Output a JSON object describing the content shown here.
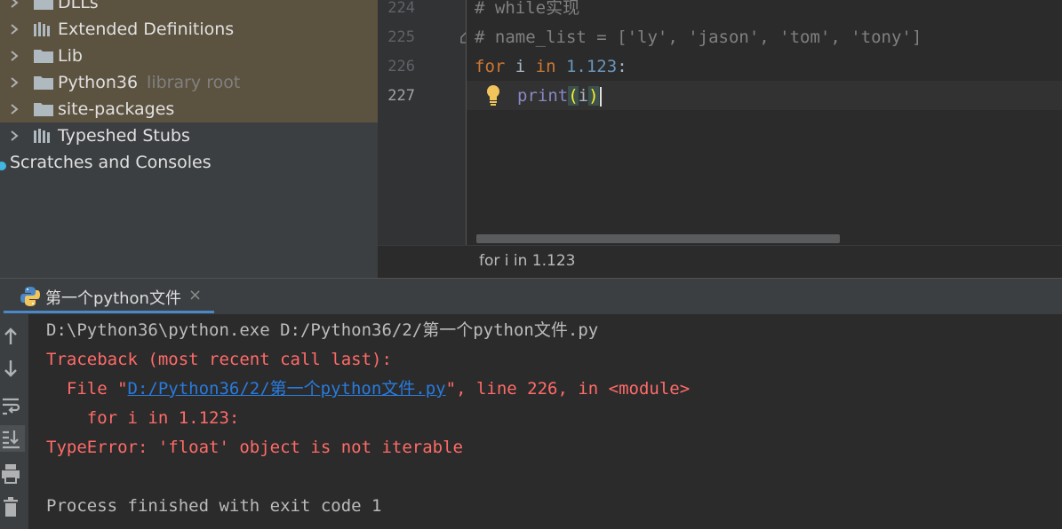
{
  "project_tree": {
    "items": [
      {
        "label": "DLLs",
        "icon": "folder-icon"
      },
      {
        "label": "Extended Definitions",
        "icon": "library-icon"
      },
      {
        "label": "Lib",
        "icon": "folder-icon"
      },
      {
        "label": "Python36",
        "sub": "library root",
        "icon": "folder-icon"
      },
      {
        "label": "site-packages",
        "icon": "folder-icon"
      },
      {
        "label": "Typeshed Stubs",
        "icon": "library-icon"
      },
      {
        "label": "Scratches and Consoles",
        "icon": "scratches-icon"
      }
    ]
  },
  "editor": {
    "line_numbers": [
      "224",
      "225",
      "226",
      "227"
    ],
    "current_line": "227",
    "lines": {
      "l224": "# while实现",
      "l225": "# name_list = ['ly', 'jason', 'tom', 'tony']",
      "l226_kw1": "for",
      "l226_var": " i ",
      "l226_kw2": "in",
      "l226_num": " 1.123",
      "l226_colon": ":",
      "l227_fn": "print",
      "l227_open": "(",
      "l227_arg": "i",
      "l227_close": ")"
    },
    "breadcrumb": "for i in 1.123"
  },
  "run_window": {
    "tab_title": "第一个python文件",
    "close_glyph": "×",
    "output": {
      "cmd": "D:\\Python36\\python.exe D:/Python36/2/第一个python文件.py",
      "traceback": "Traceback (most recent call last):",
      "file_prefix": "  File \"",
      "file_link": "D:/Python36/2/第一个python文件.py",
      "file_suffix": "\", line 226, in <module>",
      "code_line": "    for i in 1.123:",
      "error": "TypeError: 'float' object is not iterable",
      "finished": "Process finished with exit code 1"
    }
  },
  "colors": {
    "keyword": "#cc7832",
    "number": "#6897bb",
    "comment": "#808080",
    "error_text": "#ff6b68",
    "link": "#287bde",
    "selection_tree": "#5c5240",
    "accent": "#4a88c7"
  }
}
